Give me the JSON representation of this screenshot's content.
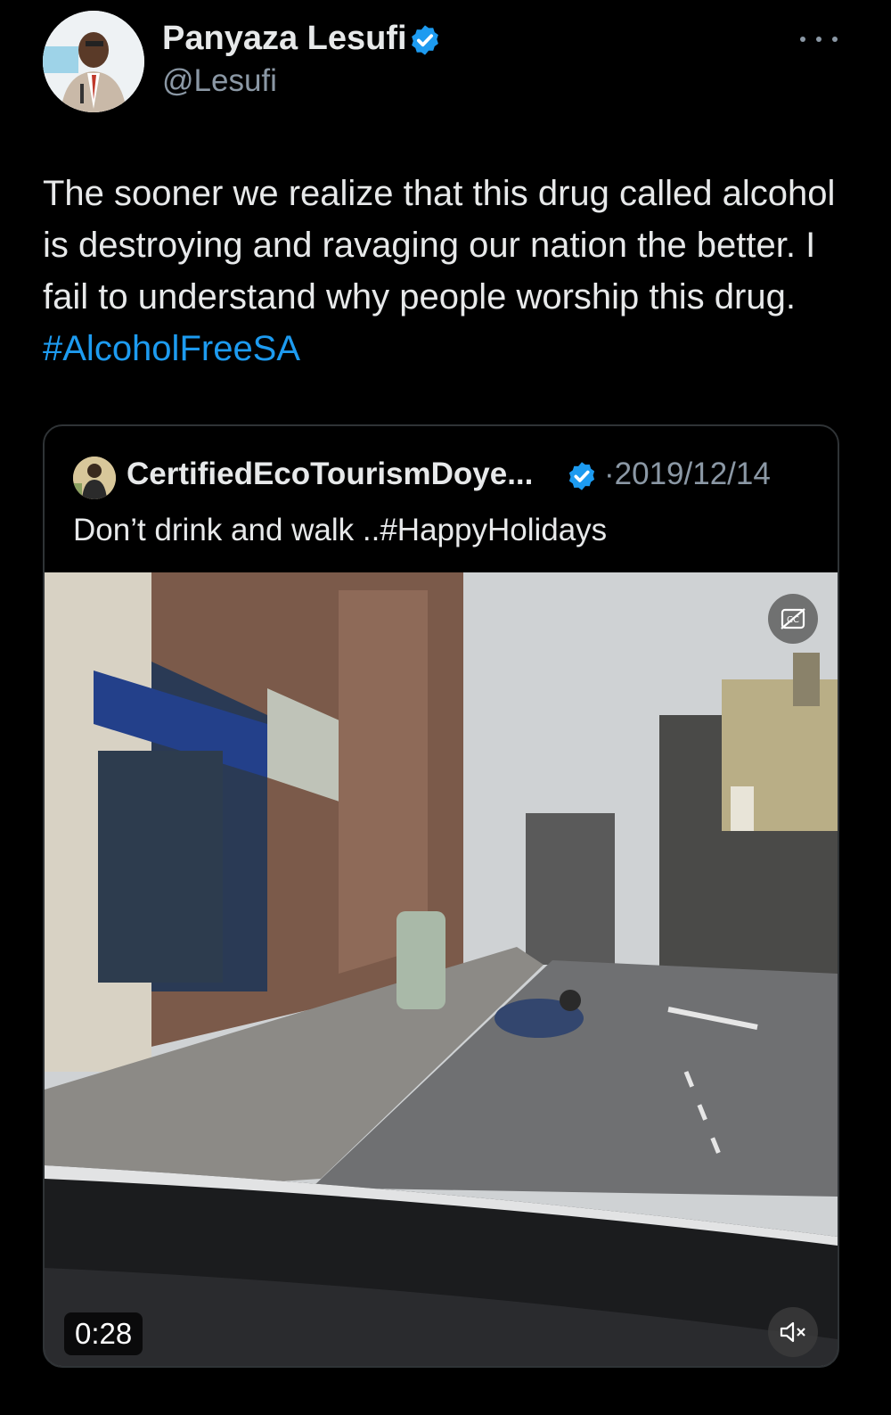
{
  "author": {
    "display_name": "Panyaza Lesufi",
    "handle": "@Lesufi",
    "verified": true
  },
  "tweet": {
    "text_before": "The sooner we realize that this drug called alcohol is destroying and ravaging our nation the better. I fail to understand why people worship this drug. ",
    "hashtag": "#AlcoholFreeSA"
  },
  "quoted_tweet": {
    "display_name": "CertifiedEcoTourismDoye...",
    "date_separator": "·",
    "date": "2019/12/14",
    "text": "Don’t drink and walk ..#HappyHolidays",
    "verified": true
  },
  "video": {
    "duration": "0:28",
    "captions_icon": "captions-off-icon",
    "mute_icon": "speaker-muted-icon"
  },
  "icons": {
    "more": "more-horizontal-icon",
    "verified": "verified-badge-icon"
  },
  "colors": {
    "background": "#000000",
    "text": "#e7e9ea",
    "secondary": "#8b98a5",
    "accent": "#1d9bf0",
    "border": "#2f3336"
  }
}
